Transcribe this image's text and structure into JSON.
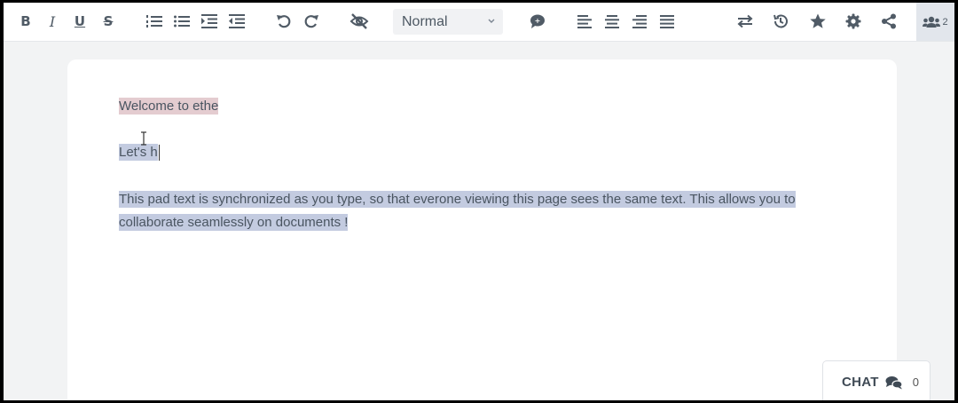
{
  "toolbar": {
    "bold_label": "B",
    "italic_label": "I",
    "underline_label": "U",
    "strike_label": "S",
    "heading_select": {
      "selected": "Normal"
    },
    "user_count": "2"
  },
  "document": {
    "line1": "Welcome to ethe",
    "line2": "Let's h",
    "paragraph": "This pad text is synchronized as you type, so that everone viewing this page sees the same text. This allows you to collaborate seamlessly on documents !"
  },
  "chat": {
    "label": "CHAT",
    "count": "0"
  },
  "colors": {
    "highlight_author_1": "#e4ccd0",
    "highlight_author_2": "#c3cbe0",
    "toolbar_icon": "#505b66",
    "background": "#f2f3f4"
  },
  "icons": [
    "bold",
    "italic",
    "underline",
    "strikethrough",
    "ordered-list-icon",
    "unordered-list-icon",
    "indent-icon",
    "outdent-icon",
    "undo-icon",
    "redo-icon",
    "eye-slash-icon",
    "comment-icon",
    "align-left-icon",
    "align-center-icon",
    "align-right-icon",
    "align-justify-icon",
    "import-export-icon",
    "history-icon",
    "star-icon",
    "gear-icon",
    "share-icon",
    "users-icon",
    "chat-bubbles-icon"
  ]
}
